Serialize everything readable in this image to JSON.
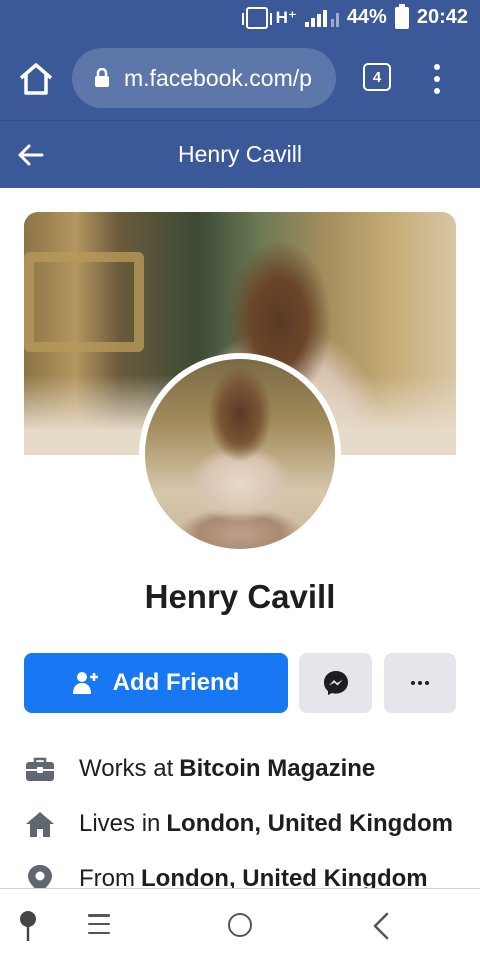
{
  "status_bar": {
    "network": "H⁺",
    "battery": "44%",
    "time": "20:42"
  },
  "browser": {
    "url": "m.facebook.com/p",
    "tab_count": "4"
  },
  "header": {
    "title": "Henry Cavill"
  },
  "profile": {
    "name": "Henry Cavill",
    "add_friend_label": "Add Friend"
  },
  "intro": [
    {
      "prefix": "Works at",
      "value": "Bitcoin Magazine",
      "icon": "briefcase-icon"
    },
    {
      "prefix": "Lives in",
      "value": "London, United Kingdom",
      "icon": "home-icon"
    },
    {
      "prefix": "From",
      "value": "London, United Kingdom",
      "icon": "location-pin-icon"
    }
  ],
  "colors": {
    "brand": "#3b5998",
    "primary_button": "#1877f2",
    "secondary_button": "#e4e6eb"
  }
}
